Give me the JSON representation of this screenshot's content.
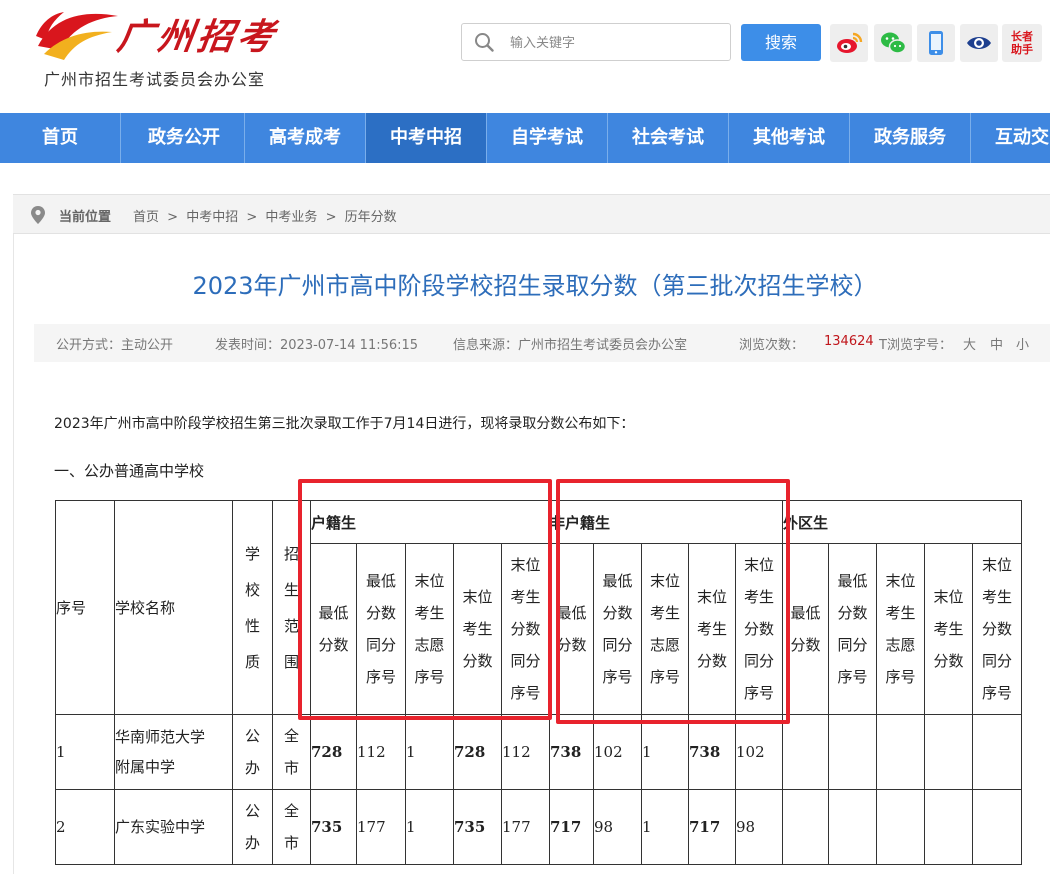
{
  "header": {
    "logo_text": "广州招考",
    "subtitle": "广州市招生考试委员会办公室",
    "search_placeholder": "输入关键字",
    "search_button": "搜索",
    "elder_badge_line1": "长者",
    "elder_badge_line2": "助手",
    "icons": [
      "weibo-icon",
      "wechat-icon",
      "mobile-icon",
      "eye-icon",
      "elder-assist-icon"
    ]
  },
  "nav": {
    "items": [
      {
        "label": "首页"
      },
      {
        "label": "政务公开"
      },
      {
        "label": "高考成考"
      },
      {
        "label": "中考中招"
      },
      {
        "label": "自学考试"
      },
      {
        "label": "社会考试"
      },
      {
        "label": "其他考试"
      },
      {
        "label": "政务服务"
      },
      {
        "label": "互动交"
      }
    ],
    "active": "中考中招"
  },
  "breadcrumb": {
    "label": "当前位置",
    "items": [
      "首页",
      "中考中招",
      "中考业务",
      "历年分数"
    ],
    "separator": ">"
  },
  "article": {
    "title": "2023年广州市高中阶段学校招生录取分数（第三批次招生学校）",
    "meta": {
      "publicity": "公开方式：主动公开",
      "date": "发表时间：2023-07-14 11:56:15",
      "source": "信息来源：广州市招生考试委员会办公室",
      "views_label": "浏览次数：",
      "views": "134624",
      "font_label": "T浏览字号：",
      "font_large": "大",
      "font_medium": "中",
      "font_small": "小"
    },
    "intro": "2023年广州市高中阶段学校招生第三批次录取工作于7月14日进行，现将录取分数公布如下：",
    "section": "一、公办普通高中学校"
  },
  "table": {
    "headers": {
      "index": "序号",
      "school": "学校名称",
      "nature": [
        "学",
        "校",
        "性",
        "质"
      ],
      "scope": [
        "招",
        "生",
        "范",
        "围"
      ],
      "groups": [
        "户籍生",
        "非户籍生",
        "外区生"
      ],
      "sub": [
        [
          "最低",
          "分数"
        ],
        [
          "最低",
          "分数",
          "同分",
          "序号"
        ],
        [
          "末位",
          "考生",
          "志愿",
          "序号"
        ],
        [
          "末位",
          "考生",
          "分数"
        ],
        [
          "末位",
          "考生",
          "分数",
          "同分",
          "序号"
        ]
      ]
    },
    "rows": [
      {
        "index": "1",
        "school": [
          "华南师范大学",
          "附属中学"
        ],
        "nature": [
          "公",
          "办"
        ],
        "scope": [
          "全",
          "市"
        ],
        "huji": [
          "728",
          "112",
          "1",
          "728",
          "112"
        ],
        "feihuji": [
          "738",
          "102",
          "1",
          "738",
          "102"
        ],
        "waiqu": [
          "",
          "",
          "",
          "",
          ""
        ]
      },
      {
        "index": "2",
        "school": [
          "广东实验中学"
        ],
        "nature": [
          "公",
          "办"
        ],
        "scope": [
          "全",
          "市"
        ],
        "huji": [
          "735",
          "177",
          "1",
          "735",
          "177"
        ],
        "feihuji": [
          "717",
          "98",
          "1",
          "717",
          "98"
        ],
        "waiqu": [
          "",
          "",
          "",
          "",
          ""
        ]
      }
    ]
  },
  "colors": {
    "nav_bg": "#3f86df",
    "nav_active": "#2c6fc4",
    "title": "#2d6dba",
    "highlight_box": "#e8232d",
    "views_number": "#c0161b",
    "search_button": "#3d8ee8"
  }
}
